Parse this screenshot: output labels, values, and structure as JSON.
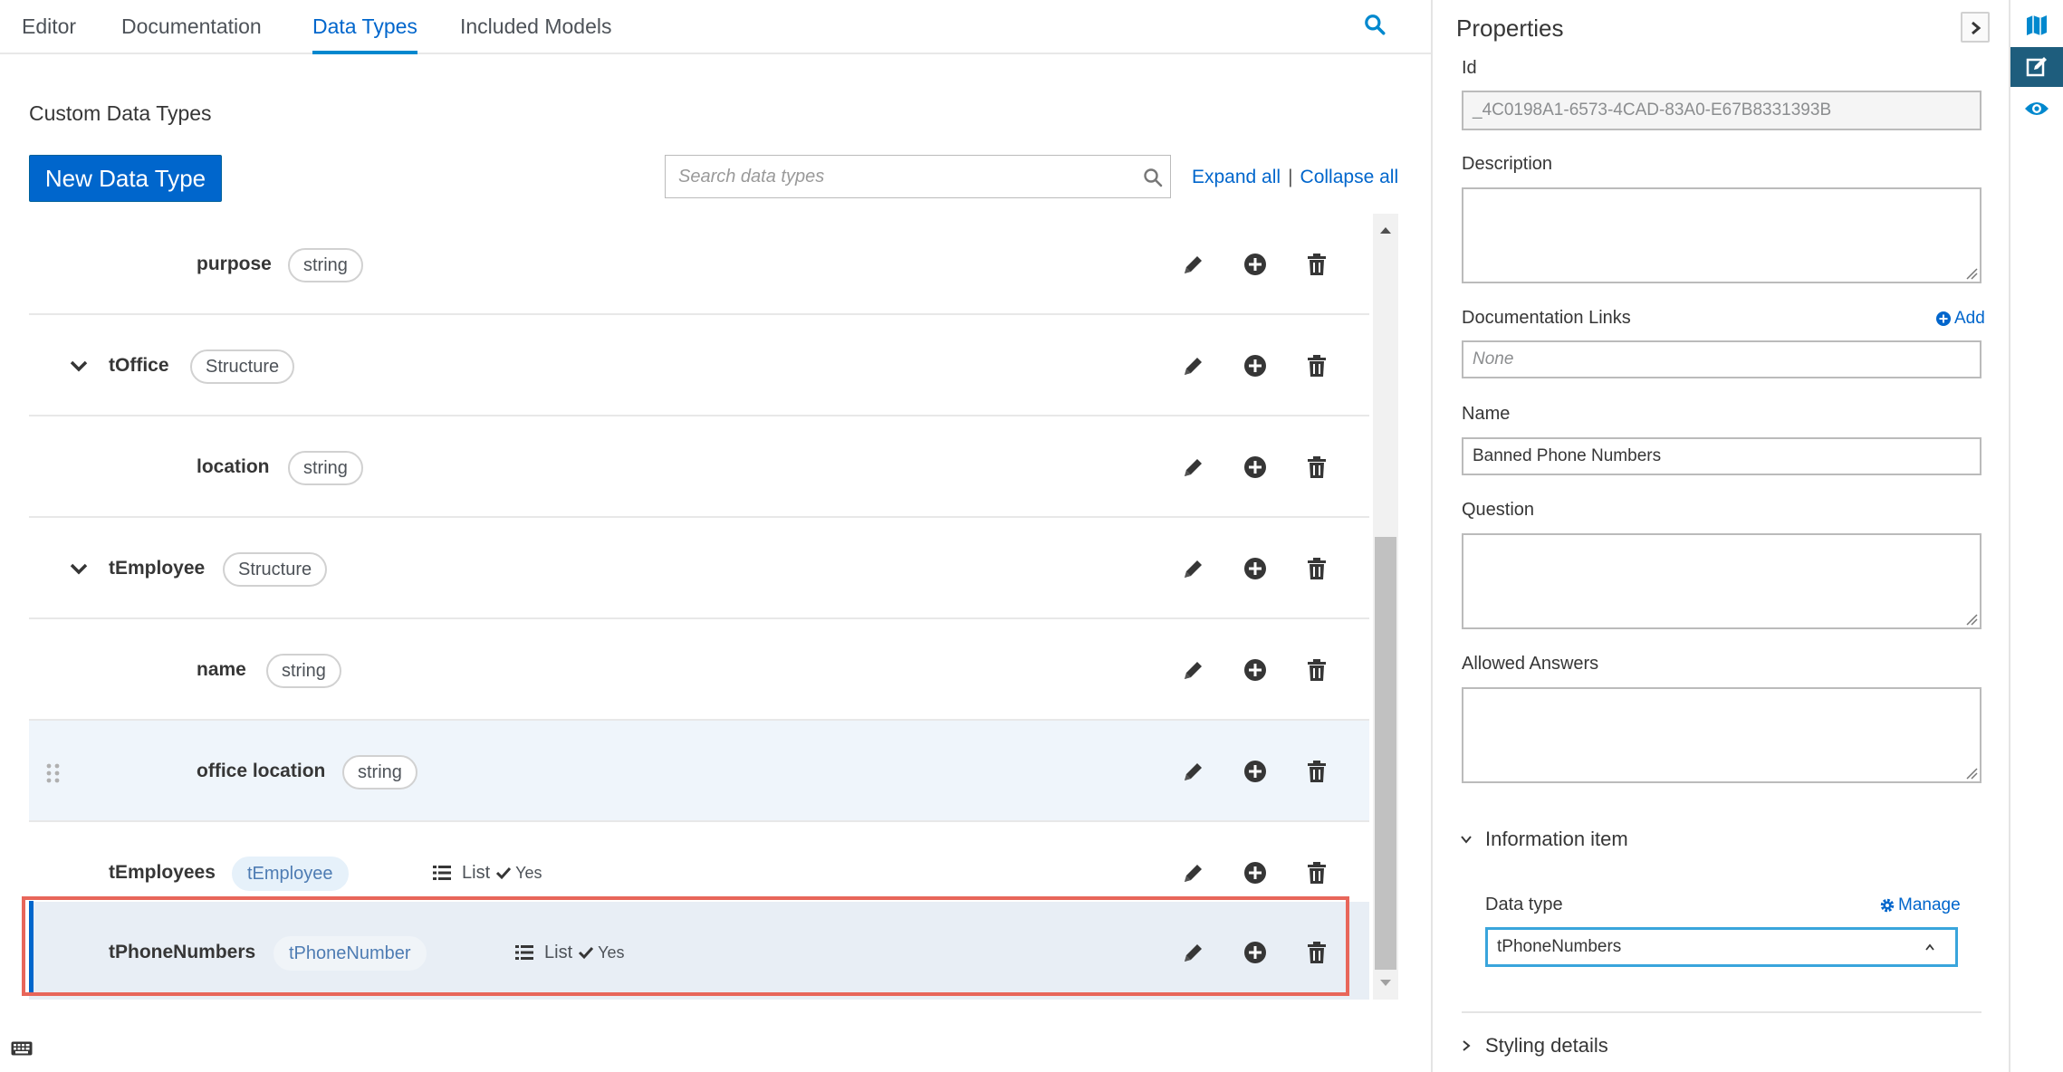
{
  "tabs": [
    {
      "label": "Editor",
      "active": false
    },
    {
      "label": "Documentation",
      "active": false
    },
    {
      "label": "Data Types",
      "active": true
    },
    {
      "label": "Included Models",
      "active": false
    }
  ],
  "main": {
    "section_title": "Custom Data Types",
    "new_button": "New Data Type",
    "search_placeholder": "Search data types",
    "expand_all": "Expand all",
    "separator": "|",
    "collapse_all": "Collapse all"
  },
  "rows": [
    {
      "name": "purpose",
      "type": "string"
    },
    {
      "name": "tOffice",
      "type": "Structure"
    },
    {
      "name": "location",
      "type": "string"
    },
    {
      "name": "tEmployee",
      "type": "Structure"
    },
    {
      "name": "name",
      "type": "string"
    },
    {
      "name": "office location",
      "type": "string"
    },
    {
      "name": "tEmployees",
      "type": "tEmployee",
      "list_label": "List",
      "list_value": "Yes"
    },
    {
      "name": "tPhoneNumbers",
      "type": "tPhoneNumber",
      "list_label": "List",
      "list_value": "Yes"
    }
  ],
  "properties": {
    "title": "Properties",
    "id_label": "Id",
    "id_value": "_4C0198A1-6573-4CAD-83A0-E67B8331393B",
    "description_label": "Description",
    "description_value": "",
    "doc_links_label": "Documentation Links",
    "add_label": "Add",
    "doc_links_placeholder": "None",
    "name_label": "Name",
    "name_value": "Banned Phone Numbers",
    "question_label": "Question",
    "question_value": "",
    "allowed_answers_label": "Allowed Answers",
    "allowed_answers_value": "",
    "info_item_label": "Information item",
    "data_type_label": "Data type",
    "manage_label": "Manage",
    "data_type_value": "tPhoneNumbers",
    "styling_label": "Styling details"
  },
  "colors": {
    "accent": "#0066cc",
    "selection_outline": "#e8665a",
    "selected_row": "#e8eef5",
    "iconbar_active": "#1e5d7d"
  },
  "icons": {
    "tab_search": "search-icon",
    "row_actions": [
      "pencil-icon",
      "plus-circle-icon",
      "trash-icon"
    ],
    "list": "list-icon",
    "check": "check-icon",
    "iconbar": [
      "map-icon",
      "edit-icon",
      "eye-icon"
    ]
  }
}
